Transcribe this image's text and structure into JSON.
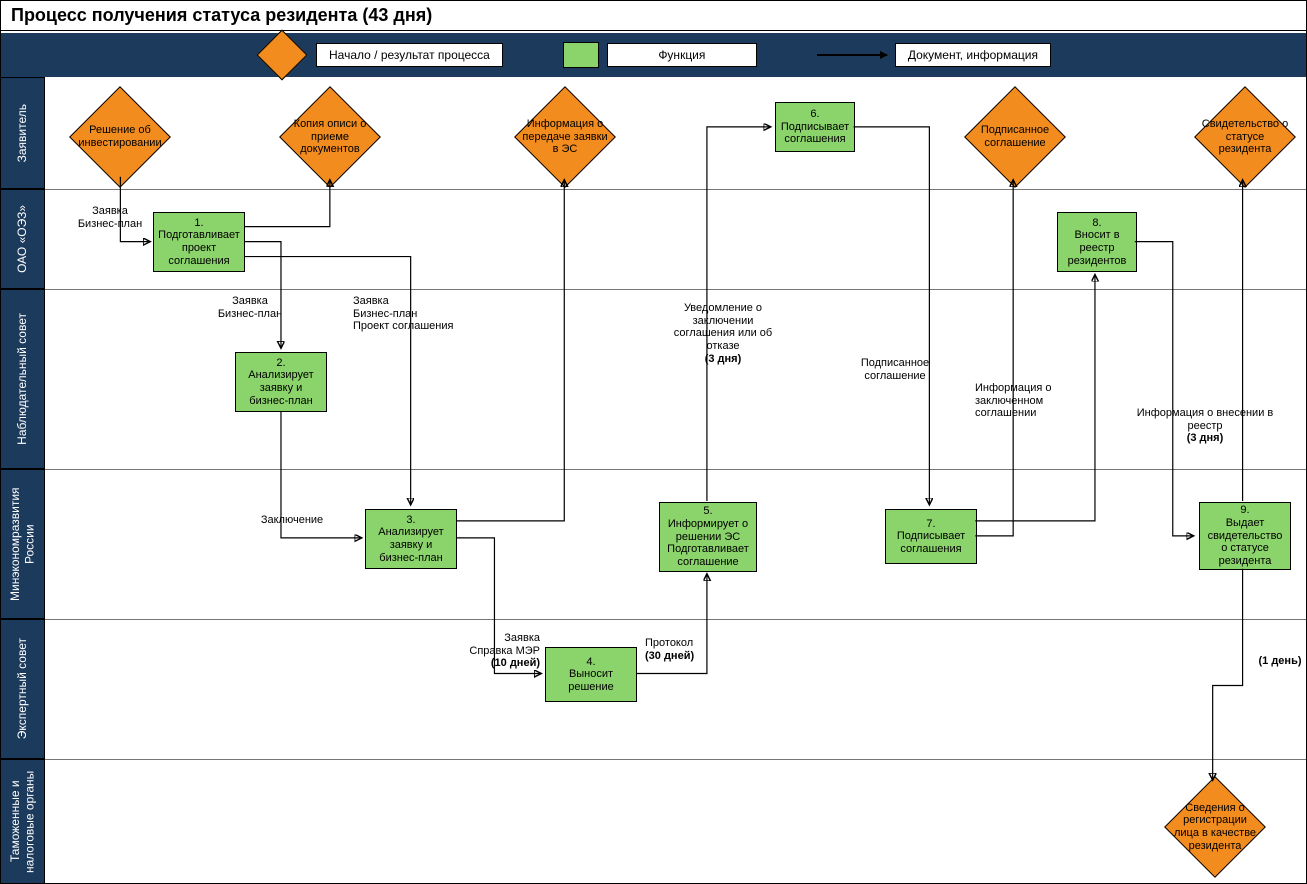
{
  "title": "Процесс получения статуса резидента (43 дня)",
  "legend": {
    "start": "Начало / результат процесса",
    "function": "Функция",
    "doc": "Документ, информация"
  },
  "lanes": {
    "l1": "Заявитель",
    "l2": "ОАО «ОЭЗ»",
    "l3": "Наблюдательный совет",
    "l4": "Минэкономразвития России",
    "l5": "Экспертный совет",
    "l6": "Таможенные и налоговые органы"
  },
  "shapes": {
    "d1": "Решение об инвестировании",
    "d2": "Копия описи о приеме документов",
    "d3": "Информация о передаче заявки в ЭС",
    "d4": "Подписанное соглашение",
    "d5": "Свидетельство о статусе резидента",
    "d6": "Сведения о регистрации лица в качестве резидента",
    "p1": "1.\nПодготавливает проект соглашения",
    "p2": "2.\nАнализирует заявку и бизнес-план",
    "p3": "3.\nАнализирует заявку и бизнес-план",
    "p4": "4.\nВыносит решение",
    "p5": "5.\nИнформирует о решении ЭС Подготавливает соглашение",
    "p6": "6.\nПодписывает соглашения",
    "p7": "7.\nПодписывает соглашения",
    "p8": "8.\nВносит в реестр резидентов",
    "p9": "9.\nВыдает свидетельство о статусе резидента"
  },
  "notes": {
    "n1": "Заявка\nБизнес-план",
    "n2": "Заявка\nБизнес-план",
    "n3": "Заявка\nБизнес-план\nПроект соглашения",
    "n4": "Заключение",
    "n5": "Заявка\nСправка МЭР\n(10 дней)",
    "n6": "Протокол\n(30 дней)",
    "n7": "Уведомление о заключении соглашения или об отказе\n(3 дня)",
    "n8": "Подписанное соглашение",
    "n9": "Информация о заключенном соглашении",
    "n10": "Информация о внесении в реестр\n(3 дня)",
    "n11": "(1 день)"
  }
}
